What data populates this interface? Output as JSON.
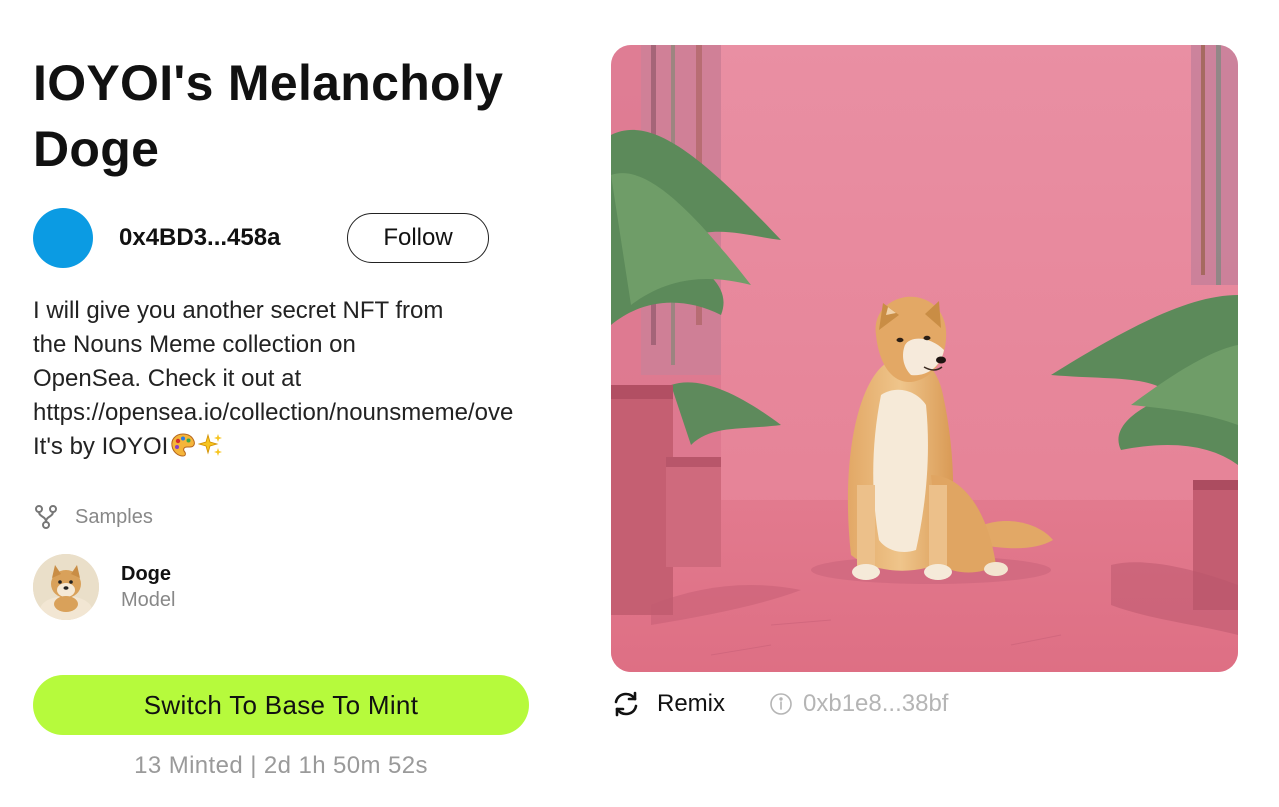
{
  "title": "IOYOI's Melancholy Doge",
  "creator": {
    "name": "0x4BD3...458a",
    "avatar_color": "#0b9be3",
    "follow_label": "Follow"
  },
  "description": {
    "lines": [
      "I will give you another secret NFT from",
      "the Nouns Meme collection on",
      "OpenSea. Check it out at",
      "https://opensea.io/collection/nounsmeme/ove",
      "It's by IOYOI"
    ],
    "trailing_emojis": [
      "artist-palette-icon",
      "sparkles-icon"
    ]
  },
  "samples": {
    "label": "Samples",
    "icon": "fork-icon"
  },
  "model": {
    "name": "Doge",
    "type": "Model"
  },
  "mint": {
    "button_label": "Switch To Base To Mint",
    "button_color": "#b6fa3c",
    "status": "13 Minted | 2d 1h 50m 52s"
  },
  "artwork": {
    "icon": "doge-artwork-image",
    "background_color": "#e68c9e"
  },
  "remix": {
    "label": "Remix",
    "icon": "refresh-icon"
  },
  "token": {
    "address": "0xb1e8...38bf",
    "icon": "info-icon"
  }
}
